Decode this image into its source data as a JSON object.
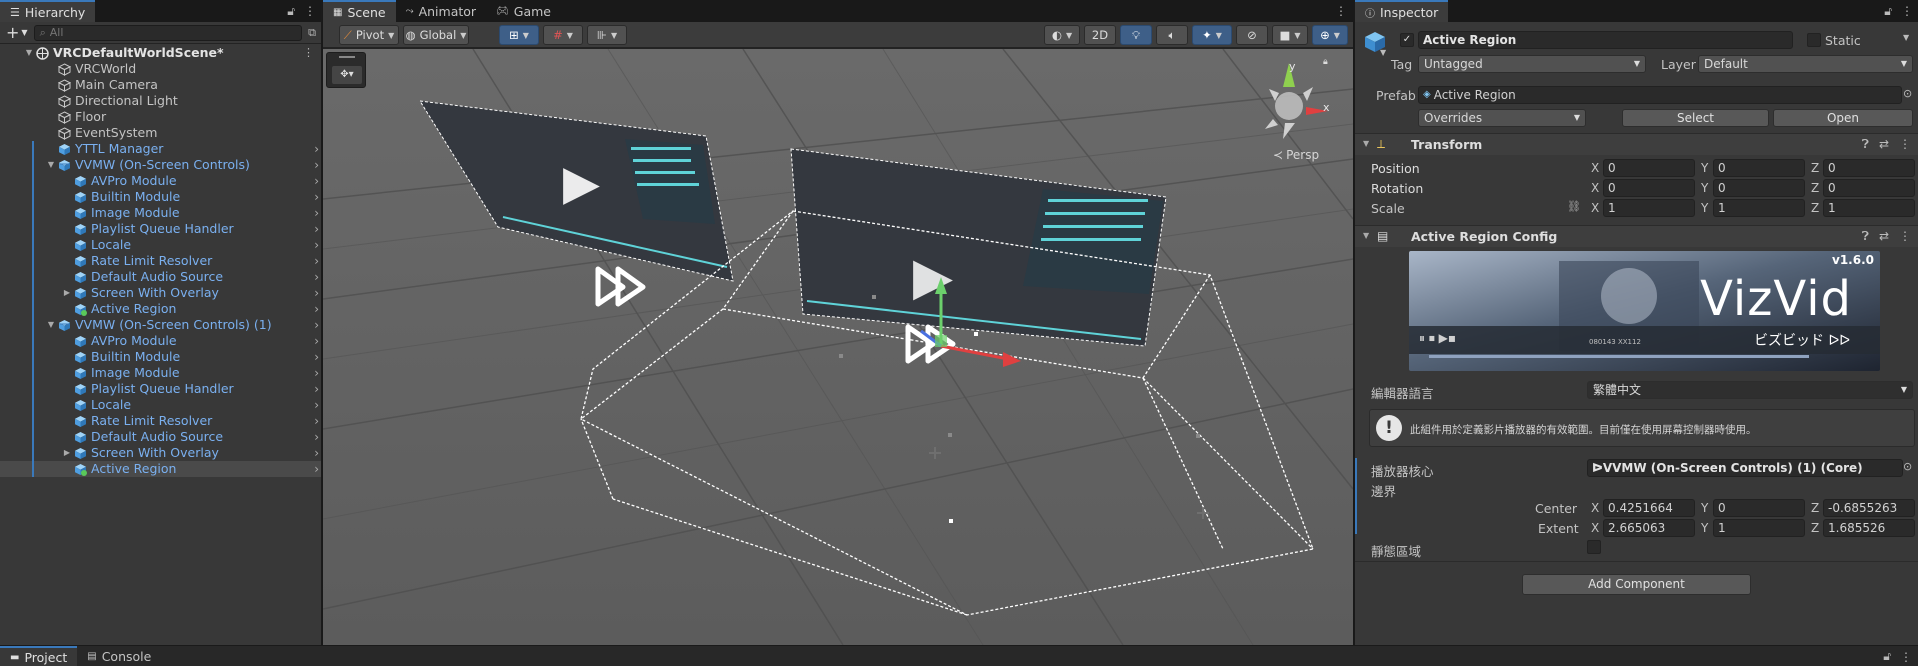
{
  "hierarchy": {
    "tab_label": "Hierarchy",
    "search_placeholder": "All",
    "rows": [
      {
        "label": "VRCDefaultWorldScene*",
        "depth": 0,
        "icon": "unity-scene-icon",
        "arrow": "down",
        "style": "bold",
        "menu": true
      },
      {
        "label": "VRCWorld",
        "depth": 1,
        "icon": "gameobject-icon"
      },
      {
        "label": "Main Camera",
        "depth": 1,
        "icon": "gameobject-icon"
      },
      {
        "label": "Directional Light",
        "depth": 1,
        "icon": "gameobject-icon"
      },
      {
        "label": "Floor",
        "depth": 1,
        "icon": "gameobject-icon"
      },
      {
        "label": "EventSystem",
        "depth": 1,
        "icon": "gameobject-icon"
      },
      {
        "label": "YTTL Manager",
        "depth": 1,
        "icon": "prefab-icon",
        "style": "blue",
        "chevron": true,
        "bar": true
      },
      {
        "label": "VVMW (On-Screen Controls)",
        "depth": 1,
        "icon": "prefab-variant-icon",
        "arrow": "down",
        "style": "blue",
        "chevron": true,
        "bar": true
      },
      {
        "label": "AVPro Module",
        "depth": 2,
        "icon": "prefab-icon",
        "style": "blue",
        "chevron": true,
        "bar": true
      },
      {
        "label": "Builtin Module",
        "depth": 2,
        "icon": "prefab-icon",
        "style": "blue",
        "chevron": true,
        "bar": true
      },
      {
        "label": "Image Module",
        "depth": 2,
        "icon": "prefab-icon",
        "style": "blue",
        "chevron": true,
        "bar": true
      },
      {
        "label": "Playlist Queue Handler",
        "depth": 2,
        "icon": "prefab-icon",
        "style": "blue",
        "chevron": true,
        "bar": true
      },
      {
        "label": "Locale",
        "depth": 2,
        "icon": "prefab-icon",
        "style": "blue",
        "chevron": true,
        "bar": true
      },
      {
        "label": "Rate Limit Resolver",
        "depth": 2,
        "icon": "prefab-icon",
        "style": "blue",
        "chevron": true,
        "bar": true
      },
      {
        "label": "Default Audio Source",
        "depth": 2,
        "icon": "prefab-icon",
        "style": "blue",
        "chevron": true,
        "bar": true
      },
      {
        "label": "Screen With Overlay",
        "depth": 2,
        "icon": "prefab-icon",
        "arrow": "right",
        "style": "blue",
        "chevron": true,
        "bar": true
      },
      {
        "label": "Active Region",
        "depth": 2,
        "icon": "prefab-added-icon",
        "style": "blue",
        "chevron": true,
        "bar": true
      },
      {
        "label": "VVMW (On-Screen Controls) (1)",
        "depth": 1,
        "icon": "prefab-variant-icon",
        "arrow": "down",
        "style": "blue",
        "chevron": true,
        "bar": true
      },
      {
        "label": "AVPro Module",
        "depth": 2,
        "icon": "prefab-icon",
        "style": "blue",
        "chevron": true,
        "bar": true
      },
      {
        "label": "Builtin Module",
        "depth": 2,
        "icon": "prefab-icon",
        "style": "blue",
        "chevron": true,
        "bar": true
      },
      {
        "label": "Image Module",
        "depth": 2,
        "icon": "prefab-icon",
        "style": "blue",
        "chevron": true,
        "bar": true
      },
      {
        "label": "Playlist Queue Handler",
        "depth": 2,
        "icon": "prefab-icon",
        "style": "blue",
        "chevron": true,
        "bar": true
      },
      {
        "label": "Locale",
        "depth": 2,
        "icon": "prefab-icon",
        "style": "blue",
        "chevron": true,
        "bar": true
      },
      {
        "label": "Rate Limit Resolver",
        "depth": 2,
        "icon": "prefab-icon",
        "style": "blue",
        "chevron": true,
        "bar": true
      },
      {
        "label": "Default Audio Source",
        "depth": 2,
        "icon": "prefab-icon",
        "style": "blue",
        "chevron": true,
        "bar": true
      },
      {
        "label": "Screen With Overlay",
        "depth": 2,
        "icon": "prefab-icon",
        "arrow": "right",
        "style": "blue",
        "chevron": true,
        "bar": true
      },
      {
        "label": "Active Region",
        "depth": 2,
        "icon": "prefab-added-icon",
        "style": "blue",
        "chevron": true,
        "bar": true,
        "selected": true
      }
    ]
  },
  "scene": {
    "tabs": [
      {
        "label": "Scene",
        "icon": "grid-icon",
        "active": true
      },
      {
        "label": "Animator",
        "icon": "animator-icon"
      },
      {
        "label": "Game",
        "icon": "gamepad-icon"
      }
    ],
    "toolbar": {
      "pivot_label": "Pivot",
      "global_label": "Global",
      "mode_2d_label": "2D"
    },
    "persp_label": "Persp",
    "gizmo_axis_y": "y",
    "gizmo_axis_x": "x"
  },
  "inspector": {
    "tab_label": "Inspector",
    "object_name": "Active Region",
    "static_label": "Static",
    "tag_label": "Tag",
    "tag_value": "Untagged",
    "layer_label": "Layer",
    "layer_value": "Default",
    "prefab_label": "Prefab",
    "prefab_value": "Active Region",
    "overrides_value": "Overrides",
    "select_label": "Select",
    "open_label": "Open",
    "transform": {
      "title": "Transform",
      "position_label": "Position",
      "rotation_label": "Rotation",
      "scale_label": "Scale",
      "position": {
        "x": "0",
        "y": "0",
        "z": "0"
      },
      "rotation": {
        "x": "0",
        "y": "0",
        "z": "0"
      },
      "scale": {
        "x": "1",
        "y": "1",
        "z": "1"
      }
    },
    "config": {
      "title": "Active Region Config",
      "banner_version": "v1.6.0",
      "banner_title": "VizVid",
      "banner_subtitle": "ビズビッド ᐅᐅ",
      "banner_caption": "080143 XX112",
      "language_label": "編輯器語言",
      "language_value": "繁體中文",
      "info_text": "此組件用於定義影片播放器的有效範圍。目前僅在使用屏幕控制器時使用。",
      "core_label": "播放器核心",
      "core_value": "ᐅVVMW (On-Screen Controls) (1) (Core)",
      "bounds_label": "邊界",
      "center_label": "Center",
      "extent_label": "Extent",
      "center": {
        "x": "0.4251664",
        "y": "0",
        "z": "-0.6855263"
      },
      "extent": {
        "x": "2.665063",
        "y": "1",
        "z": "1.685526"
      },
      "static_region_label": "靜態區域"
    },
    "add_component_label": "Add Component"
  },
  "bottom": {
    "tabs": [
      {
        "label": "Project",
        "icon": "folder-icon",
        "active": true
      },
      {
        "label": "Console",
        "icon": "console-icon"
      }
    ]
  },
  "colors": {
    "accent": "#3a79bb",
    "prefab_blue": "#7ab0f0",
    "panel": "#383838"
  }
}
